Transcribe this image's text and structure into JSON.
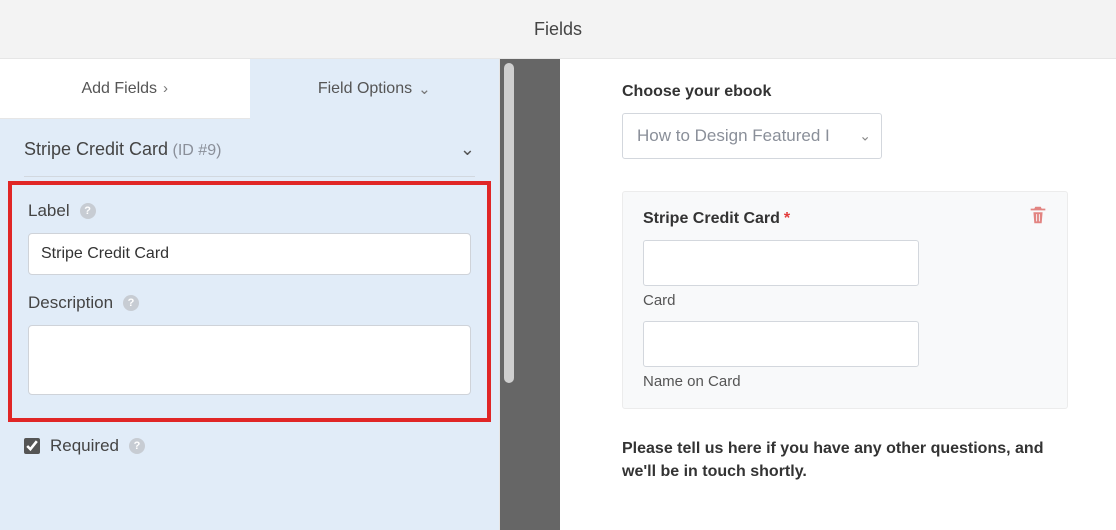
{
  "header": {
    "title": "Fields"
  },
  "tabs": {
    "add": "Add Fields",
    "options": "Field Options"
  },
  "fieldHeader": {
    "name": "Stripe Credit Card",
    "id": "(ID #9)"
  },
  "labels": {
    "label": "Label",
    "description": "Description",
    "required": "Required"
  },
  "values": {
    "label": "Stripe Credit Card",
    "description": "",
    "requiredChecked": true
  },
  "preview": {
    "chooseLabel": "Choose your ebook",
    "dropdownValue": "How to Design Featured I",
    "card": {
      "title": "Stripe Credit Card",
      "cardSub": "Card",
      "nameSub": "Name on Card"
    },
    "question": "Please tell us here if you have any other questions, and we'll be in touch shortly."
  }
}
